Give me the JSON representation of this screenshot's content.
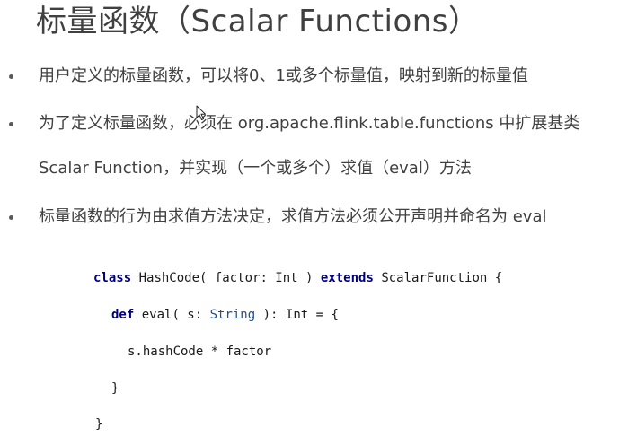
{
  "slide": {
    "title": "标量函数（Scalar Functions）"
  },
  "bullets": [
    {
      "lines": [
        "用户定义的标量函数，可以将0、1或多个标量值，映射到新的标量值"
      ]
    },
    {
      "lines": [
        "为了定义标量函数，必须在 org.apache.flink.table.functions 中扩展基类",
        "Scalar Function，并实现（一个或多个）求值（eval）方法"
      ]
    },
    {
      "lines": [
        "标量函数的行为由求值方法决定，求值方法必须公开声明并命名为 eval"
      ]
    }
  ],
  "code": {
    "line1": {
      "kw1": "class",
      "t1": " HashCode( factor: Int ) ",
      "kw2": "extends",
      "t2": " ScalarFunction {"
    },
    "line2": {
      "kw1": "def",
      "t1": " eval( s: ",
      "ty": "String",
      "t2": " ): Int = {"
    },
    "line3": "s.hashCode * factor",
    "line4": "}",
    "line5": "}"
  },
  "icons": {
    "cursor": "mouse-pointer-icon"
  }
}
